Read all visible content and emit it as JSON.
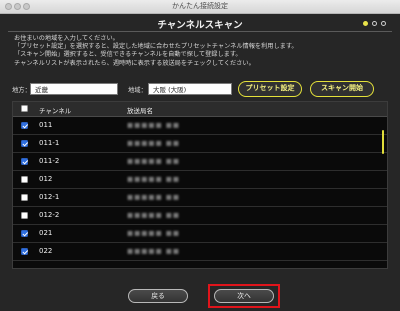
{
  "window": {
    "title": "かんたん接続設定"
  },
  "page": {
    "heading": "チャンネルスキャン",
    "steps": [
      {
        "active": true
      },
      {
        "active": false
      },
      {
        "active": false
      }
    ],
    "instructions": "お住まいの地域を入力してください。\n「プリセット設定」を選択すると、設定した地域に合わせたプリセットチャンネル情報を利用します。\n「スキャン開始」選択すると、受信できるチャンネルを自動で探して登録します。\nチャンネルリストが表示されたら、週時時に表示する放送局をチェックしてください。"
  },
  "region": {
    "area_label": "地方：",
    "area_value": "近畿",
    "locality_label": "地域：",
    "locality_value": "大阪 (大阪)",
    "preset_button": "プリセット設定",
    "scan_button": "スキャン開始"
  },
  "table": {
    "headers": {
      "channel": "チャンネル",
      "station": "放送局名"
    },
    "rows": [
      {
        "channel": "011",
        "checked": true,
        "station": "■■■■■ ■■"
      },
      {
        "channel": "011-1",
        "checked": true,
        "station": "■■■■■ ■■"
      },
      {
        "channel": "011-2",
        "checked": true,
        "station": "■■■■■ ■■"
      },
      {
        "channel": "012",
        "checked": false,
        "station": "■■■■■ ■■"
      },
      {
        "channel": "012-1",
        "checked": false,
        "station": "■■■■■ ■■"
      },
      {
        "channel": "012-2",
        "checked": false,
        "station": "■■■■■ ■■"
      },
      {
        "channel": "021",
        "checked": true,
        "station": "■■■■■ ■■"
      },
      {
        "channel": "022",
        "checked": true,
        "station": "■■■■■ ■■"
      }
    ]
  },
  "footer": {
    "back_button": "戻る",
    "next_button": "次へ"
  },
  "colors": {
    "accent_yellow": "#e4e13a",
    "highlight_red": "#e0141b",
    "checkbox_blue": "#2f6fe0"
  }
}
